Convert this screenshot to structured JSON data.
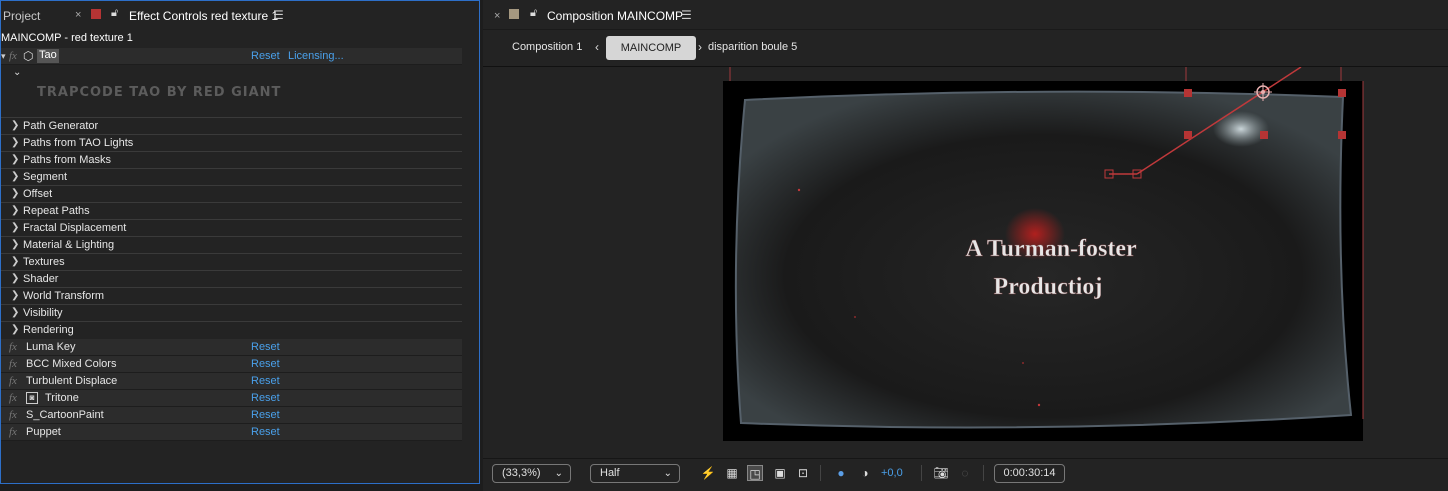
{
  "left_panel": {
    "tab_project": "Project",
    "tab_effect_controls": "Effect Controls red texture 1",
    "comp_path": "MAINCOMP - red texture 1",
    "tao": {
      "name": "Tao",
      "reset": "Reset",
      "licensing": "Licensing...",
      "brand": "TRAPCODE TAO BY RED GIANT"
    },
    "properties": [
      "Path Generator",
      "Paths from TAO Lights",
      "Paths from Masks",
      "Segment",
      "Offset",
      "Repeat Paths",
      "Fractal Displacement",
      "Material & Lighting",
      "Textures",
      "Shader",
      "World Transform",
      "Visibility",
      "Rendering"
    ],
    "effects": [
      {
        "name": "Luma Key",
        "reset": "Reset"
      },
      {
        "name": "BCC Mixed Colors",
        "reset": "Reset"
      },
      {
        "name": "Turbulent Displace",
        "reset": "Reset"
      },
      {
        "name": "Tritone",
        "reset": "Reset"
      },
      {
        "name": "S_CartoonPaint",
        "reset": "Reset"
      },
      {
        "name": "Puppet",
        "reset": "Reset"
      }
    ]
  },
  "right_panel": {
    "tab_title": "Composition MAINCOMP",
    "breadcrumbs": [
      "Composition 1",
      "MAINCOMP",
      "disparition boule 5"
    ],
    "canvas_text_line1": "A Turman-foster",
    "canvas_text_line2": "Productioj",
    "viewer_bar": {
      "zoom": "(33,3%)",
      "resolution": "Half",
      "exposure": "+0,0",
      "timecode": "0:00:30:14"
    }
  },
  "colors": {
    "accent_blue": "#4aa0ea",
    "panel_focus_border": "#2d6fc8",
    "red_swatch": "#b53434",
    "comp_swatch": "#a59880",
    "handle_red": "#c0393b"
  }
}
